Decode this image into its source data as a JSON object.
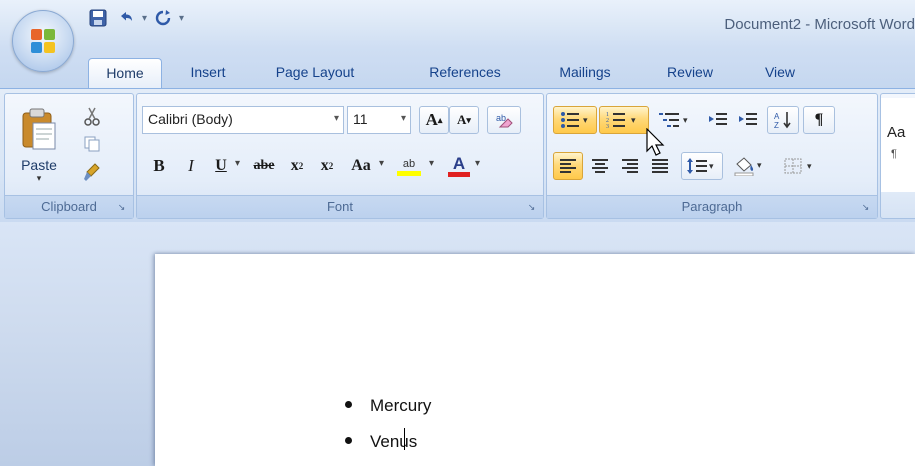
{
  "window": {
    "title": "Document2 - Microsoft Word"
  },
  "tabs": [
    {
      "label": "Home",
      "active": true
    },
    {
      "label": "Insert"
    },
    {
      "label": "Page Layout"
    },
    {
      "label": "References"
    },
    {
      "label": "Mailings"
    },
    {
      "label": "Review"
    },
    {
      "label": "View"
    }
  ],
  "clipboard": {
    "paste_label": "Paste",
    "group_label": "Clipboard"
  },
  "font": {
    "family": "Calibri (Body)",
    "size": "11",
    "group_label": "Font",
    "bold": "B",
    "italic": "I",
    "underline": "U",
    "strike": "abe",
    "subscript": "x",
    "superscript": "x",
    "change_case": "Aa",
    "grow": "A",
    "shrink": "A",
    "font_color": "A",
    "highlight": "ab"
  },
  "paragraph": {
    "group_label": "Paragraph"
  },
  "styles": {
    "preview": "Aa",
    "preview_sub": "¶"
  },
  "document": {
    "bullets": [
      "Mercury",
      "Venus"
    ]
  },
  "colors": {
    "accent": "#15428b",
    "highlight_yellow": "#ffff00",
    "font_red": "#e02020",
    "hot_orange": "#ffc94a"
  }
}
